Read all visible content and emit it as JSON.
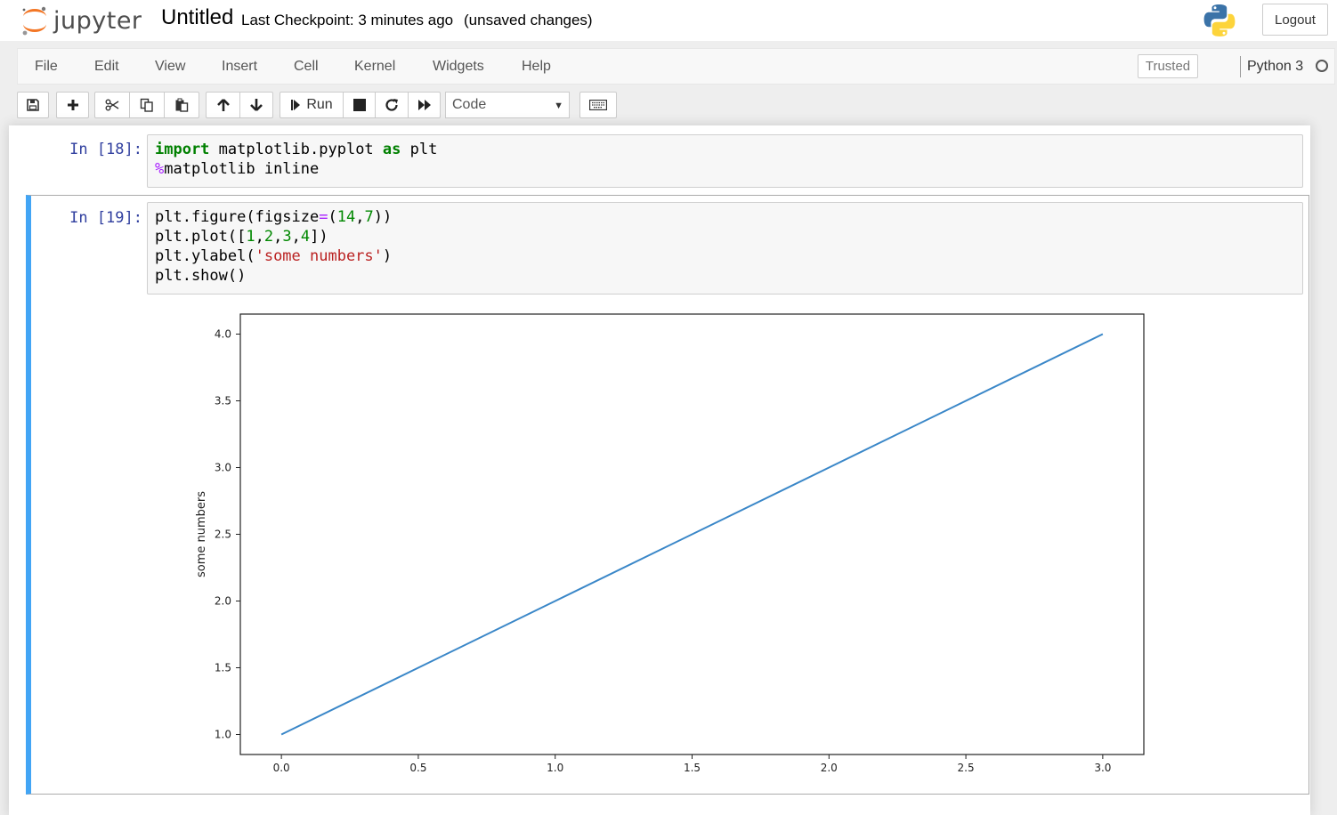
{
  "header": {
    "brand": "jupyter",
    "notebook_title": "Untitled",
    "checkpoint": "Last Checkpoint: 3 minutes ago",
    "unsaved": "(unsaved changes)",
    "logout_label": "Logout"
  },
  "menubar": {
    "items": [
      "File",
      "Edit",
      "View",
      "Insert",
      "Cell",
      "Kernel",
      "Widgets",
      "Help"
    ],
    "trusted_label": "Trusted",
    "kernel_name": "Python 3"
  },
  "toolbar": {
    "run_label": "Run",
    "cell_type": "Code"
  },
  "cells": [
    {
      "prompt": "In [18]:",
      "lines": [
        "import matplotlib.pyplot as plt",
        "%matplotlib inline"
      ]
    },
    {
      "prompt": "In [19]:",
      "lines": [
        "plt.figure(figsize=(14,7))",
        "plt.plot([1,2,3,4])",
        "plt.ylabel('some numbers')",
        "plt.show()"
      ]
    }
  ],
  "chart_data": {
    "type": "line",
    "x": [
      0,
      1,
      2,
      3
    ],
    "series": [
      {
        "values": [
          1,
          2,
          3,
          4
        ]
      }
    ],
    "xlabel": "",
    "ylabel": "some numbers",
    "xlim": [
      -0.15,
      3.15
    ],
    "ylim": [
      0.85,
      4.15
    ],
    "xticks": [
      "0.0",
      "0.5",
      "1.0",
      "1.5",
      "2.0",
      "2.5",
      "3.0"
    ],
    "yticks": [
      "1.0",
      "1.5",
      "2.0",
      "2.5",
      "3.0",
      "3.5",
      "4.0"
    ],
    "line_color": "#3a87c8",
    "grid": false
  }
}
